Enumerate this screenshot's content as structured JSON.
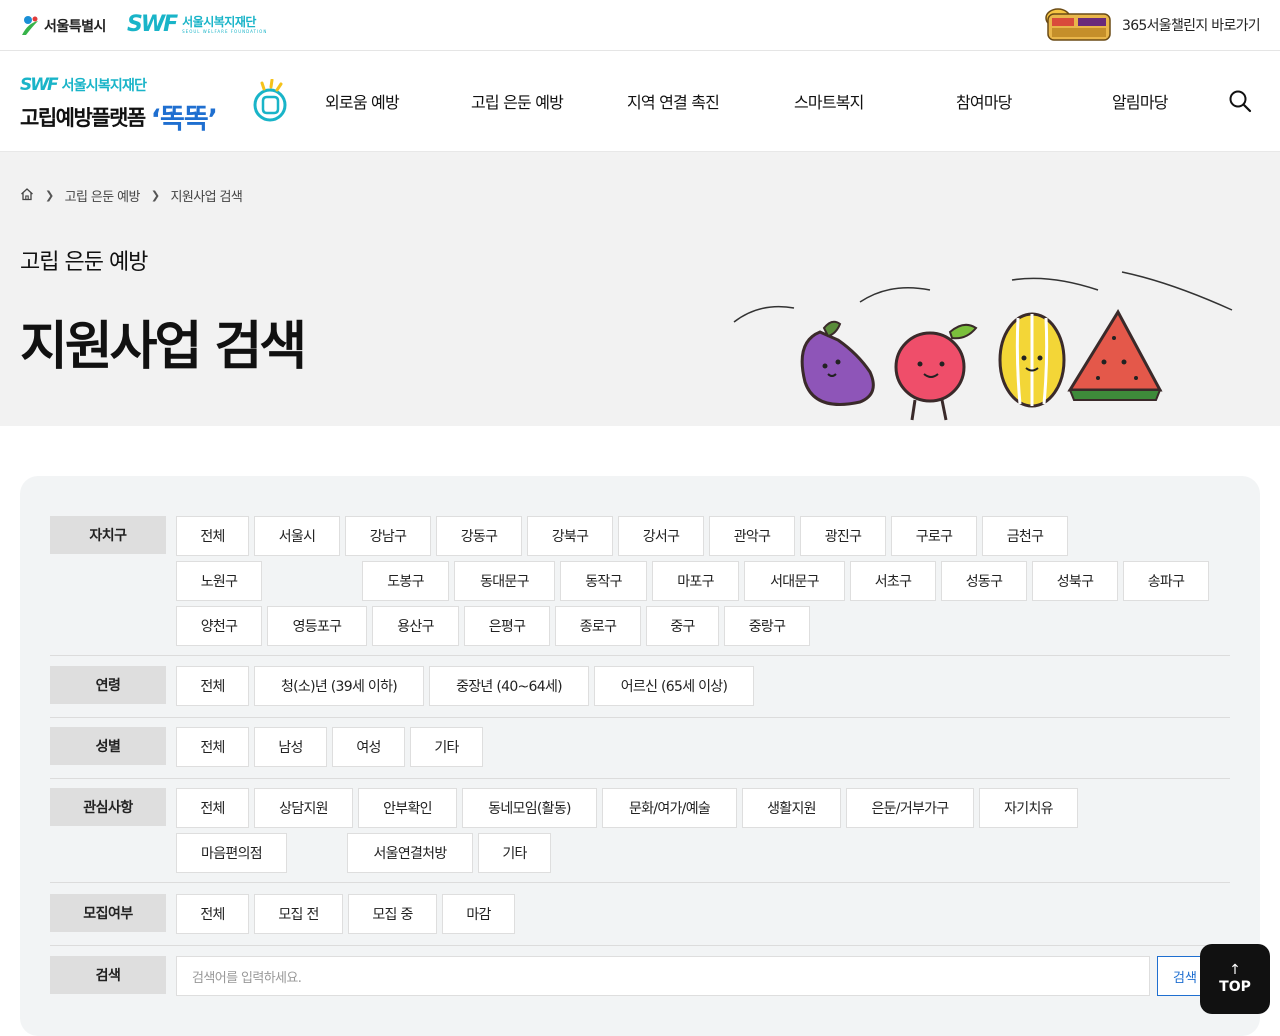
{
  "topbar": {
    "seoul_logo": "서울특별시",
    "swf_mark": "SWF",
    "swf_name": "서울시복지재단",
    "swf_sub": "SEOUL WELFARE FOUNDATION",
    "challenge_link": "365서울챌린지 바로가기"
  },
  "brand": {
    "swf": "SWF",
    "foundation": "서울시복지재단",
    "title": "고립예방플랫폼",
    "quote": "‘똑똑’"
  },
  "nav": {
    "items": [
      "외로움 예방",
      "고립 은둔 예방",
      "지역 연결 촉진",
      "스마트복지",
      "참여마당",
      "알림마당"
    ]
  },
  "hero": {
    "breadcrumb": [
      "고립 은둔 예방",
      "지원사업 검색"
    ],
    "section": "고립 은둔 예방",
    "title": "지원사업 검색"
  },
  "filters": {
    "district": {
      "label": "자치구",
      "options": [
        "전체",
        "서울시",
        "강남구",
        "강동구",
        "강북구",
        "강서구",
        "관악구",
        "광진구",
        "구로구",
        "금천구",
        "노원구",
        "도봉구",
        "동대문구",
        "동작구",
        "마포구",
        "서대문구",
        "서초구",
        "성동구",
        "성북구",
        "송파구",
        "양천구",
        "영등포구",
        "용산구",
        "은평구",
        "종로구",
        "중구",
        "중랑구"
      ]
    },
    "age": {
      "label": "연령",
      "options": [
        "전체",
        "청(소)년 (39세 이하)",
        "중장년 (40~64세)",
        "어르신 (65세 이상)"
      ]
    },
    "gender": {
      "label": "성별",
      "options": [
        "전체",
        "남성",
        "여성",
        "기타"
      ]
    },
    "interest": {
      "label": "관심사항",
      "options": [
        "전체",
        "상담지원",
        "안부확인",
        "동네모임(활동)",
        "문화/여가/예술",
        "생활지원",
        "은둔/거부가구",
        "자기치유",
        "마음편의점",
        "서울연결처방",
        "기타"
      ]
    },
    "recruit": {
      "label": "모집여부",
      "options": [
        "전체",
        "모집 전",
        "모집 중",
        "마감"
      ]
    },
    "search": {
      "label": "검색",
      "placeholder": "검색어를 입력하세요.",
      "button": "검색"
    }
  },
  "top_button": {
    "arrow": "↑",
    "label": "TOP"
  }
}
